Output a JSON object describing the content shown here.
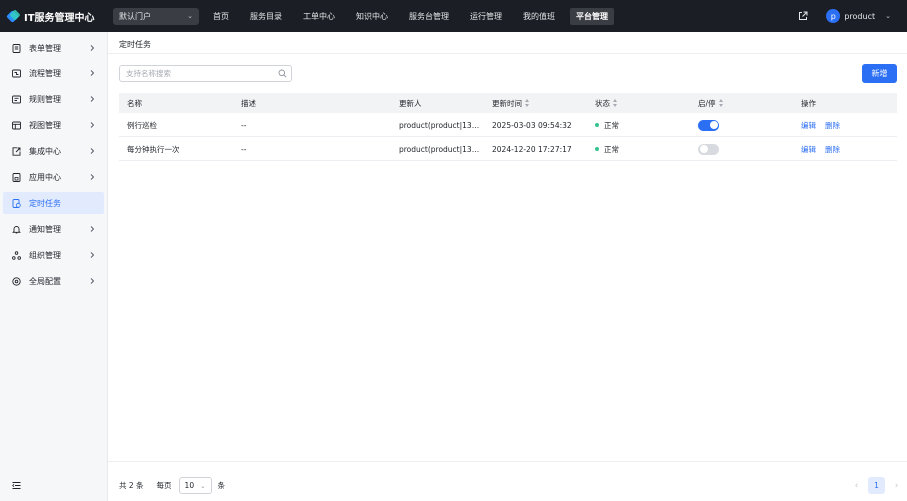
{
  "app": {
    "title": "IT服务管理中心",
    "portal": "默认门户"
  },
  "topnav": [
    "首页",
    "服务目录",
    "工单中心",
    "知识中心",
    "服务台管理",
    "运行管理",
    "我的值班",
    "平台管理"
  ],
  "topnav_active": "平台管理",
  "user": {
    "avatar_letter": "p",
    "name": "product"
  },
  "sidebar": [
    {
      "label": "表单管理",
      "icon": "form-icon"
    },
    {
      "label": "流程管理",
      "icon": "process-icon"
    },
    {
      "label": "规则管理",
      "icon": "rule-icon"
    },
    {
      "label": "视图管理",
      "icon": "view-icon"
    },
    {
      "label": "集成中心",
      "icon": "integration-icon"
    },
    {
      "label": "应用中心",
      "icon": "app-icon"
    },
    {
      "label": "定时任务",
      "icon": "timer-task-icon"
    },
    {
      "label": "通知管理",
      "icon": "bell-icon"
    },
    {
      "label": "组织管理",
      "icon": "org-icon"
    },
    {
      "label": "全局配置",
      "icon": "settings-icon"
    }
  ],
  "sidebar_active": "定时任务",
  "page": {
    "title": "定时任务"
  },
  "search": {
    "placeholder": "支持名称搜索",
    "value": ""
  },
  "add_button": "新增",
  "table": {
    "columns": [
      "名称",
      "描述",
      "更新人",
      "更新时间",
      "状态",
      "启/停",
      "操作"
    ],
    "sortable": [
      false,
      false,
      false,
      true,
      true,
      true,
      false
    ],
    "rows": [
      {
        "name": "例行巡检",
        "desc": "--",
        "updater": "product(product|13…",
        "updated": "2025-03-03 09:54:32",
        "status": "正常",
        "enabled": true,
        "actions": [
          "编辑",
          "删除"
        ]
      },
      {
        "name": "每分钟执行一次",
        "desc": "--",
        "updater": "product(product|13…",
        "updated": "2024-12-20 17:27:17",
        "status": "正常",
        "enabled": false,
        "actions": [
          "编辑",
          "删除"
        ]
      }
    ],
    "status_color": "#34c38f"
  },
  "footer": {
    "total": "共 2 条",
    "per_page_label": "每页",
    "per_page": "10",
    "unit": "条",
    "current_page": "1"
  },
  "colors": {
    "accent": "#2b6ff4",
    "topbar": "#1b1e24"
  }
}
